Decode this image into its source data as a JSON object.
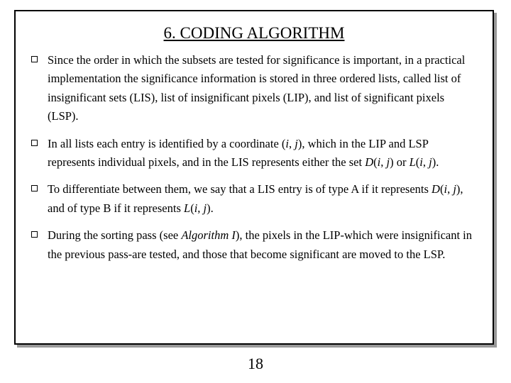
{
  "title": "6. CODING ALGORITHM",
  "bullets": {
    "b0": "Since the order in which the subsets are tested for significance is important, in a practical implementation the significance information is stored in three ordered lists, called list of insignificant sets (LIS), list of insignificant pixels (LIP), and list of significant pixels (LSP).",
    "b1_a": "In all lists each entry is identified by a coordinate (",
    "b1_b": "), which in the LIP and LSP represents individual pixels, and in the LIS represents either the set ",
    "b1_c": ") or ",
    "b1_d": ").",
    "b2_a": "To differentiate between them, we say that a LIS entry is of type A if it represents ",
    "b2_b": "), and of type B if it represents ",
    "b2_c": ").",
    "b3_a": "During the sorting pass (see ",
    "b3_b": "), the pixels in the LIP-which were insignificant in the previous pass-are tested, and those that become significant are moved to the LSP."
  },
  "sym": {
    "i": "i",
    "j": "j",
    "D": "D",
    "L": "L",
    "comma_sp": ", ",
    "open": "(",
    "algI": "Algorithm I"
  },
  "page": "18"
}
